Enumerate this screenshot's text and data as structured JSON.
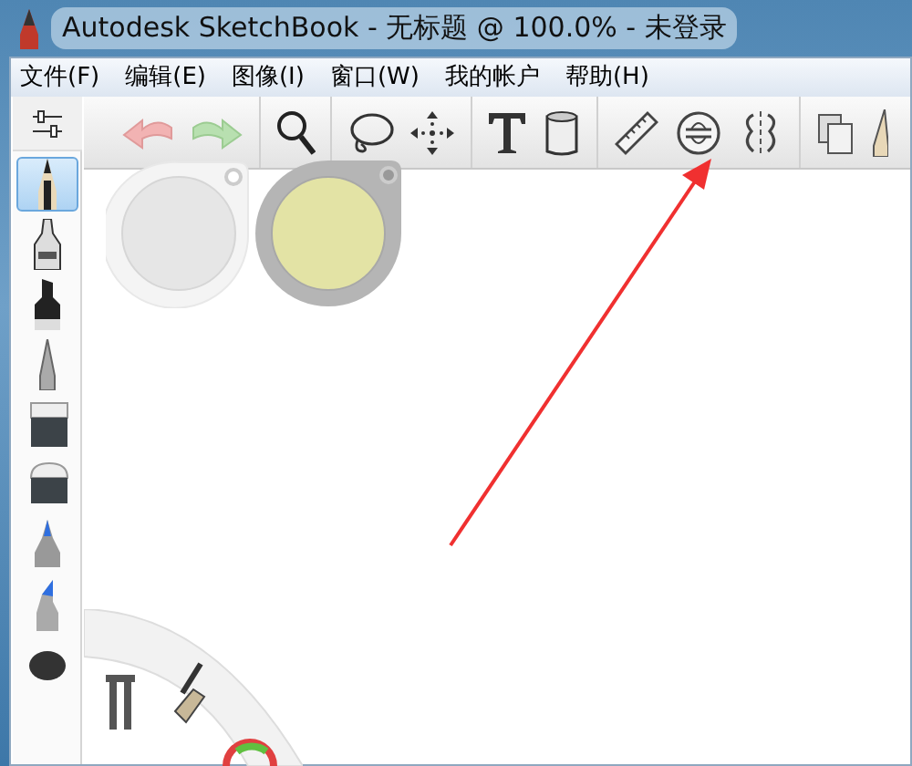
{
  "window": {
    "title": "Autodesk SketchBook - 无标题 @ 100.0% - 未登录"
  },
  "menu": [
    {
      "label": "文件(F)"
    },
    {
      "label": "编辑(E)"
    },
    {
      "label": "图像(I)"
    },
    {
      "label": "窗口(W)"
    },
    {
      "label": "我的帐户"
    },
    {
      "label": "帮助(H)"
    }
  ],
  "brushes": [
    {
      "kind": "pencil",
      "selected": true
    },
    {
      "kind": "pen",
      "selected": false
    },
    {
      "kind": "marker",
      "selected": false
    },
    {
      "kind": "airbrush",
      "selected": false
    },
    {
      "kind": "eraser-hard",
      "selected": false
    },
    {
      "kind": "eraser-soft",
      "selected": false
    },
    {
      "kind": "blue-marker",
      "selected": false
    },
    {
      "kind": "blue-chisel",
      "selected": false
    },
    {
      "kind": "dark-round",
      "selected": false
    }
  ]
}
